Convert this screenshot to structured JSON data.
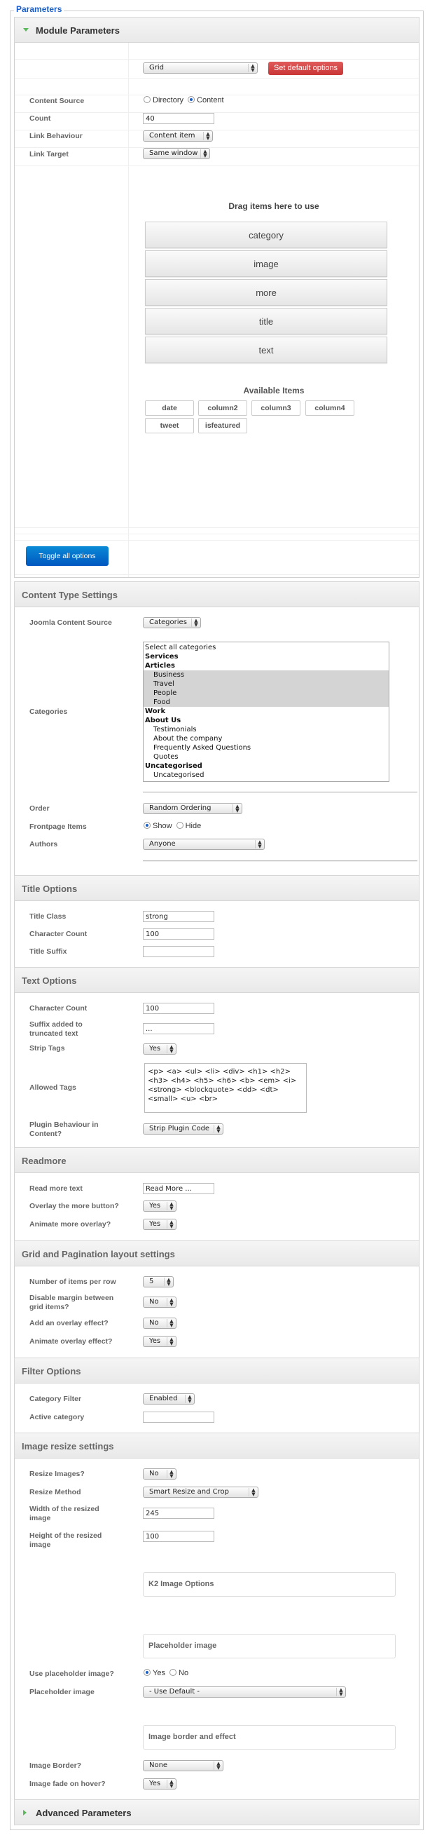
{
  "legend": "Parameters",
  "module_panel": {
    "title": "Module Parameters",
    "layout_select": "Grid",
    "set_default_button": "Set default options",
    "content_source": {
      "label": "Content Source",
      "options": [
        "Directory",
        "Content"
      ],
      "selected": "Content"
    },
    "count": {
      "label": "Count",
      "value": "40"
    },
    "link_behaviour": {
      "label": "Link Behaviour",
      "value": "Content item"
    },
    "link_target": {
      "label": "Link Target",
      "value": "Same window"
    },
    "drag_title": "Drag items here to use",
    "used_items": [
      "category",
      "image",
      "more",
      "title",
      "text"
    ],
    "available_title": "Available Items",
    "available_items": [
      "date",
      "column2",
      "column3",
      "column4",
      "tweet",
      "isfeatured"
    ],
    "toggle_button": "Toggle all options"
  },
  "content_type": {
    "title": "Content Type Settings",
    "joomla_source": {
      "label": "Joomla Content Source",
      "value": "Categories"
    },
    "categories": {
      "label": "Categories",
      "options": [
        {
          "text": "Select all categories",
          "level": 0,
          "bold": false,
          "selected": false
        },
        {
          "text": "Services",
          "level": 0,
          "bold": true,
          "selected": false
        },
        {
          "text": "Articles",
          "level": 0,
          "bold": true,
          "selected": false
        },
        {
          "text": "Business",
          "level": 1,
          "bold": false,
          "selected": true
        },
        {
          "text": "Travel",
          "level": 1,
          "bold": false,
          "selected": true
        },
        {
          "text": "People",
          "level": 1,
          "bold": false,
          "selected": true
        },
        {
          "text": "Food",
          "level": 1,
          "bold": false,
          "selected": true
        },
        {
          "text": "Work",
          "level": 0,
          "bold": true,
          "selected": false
        },
        {
          "text": "About Us",
          "level": 0,
          "bold": true,
          "selected": false
        },
        {
          "text": "Testimonials",
          "level": 1,
          "bold": false,
          "selected": false
        },
        {
          "text": "About the company",
          "level": 1,
          "bold": false,
          "selected": false
        },
        {
          "text": "Frequently Asked Questions",
          "level": 1,
          "bold": false,
          "selected": false
        },
        {
          "text": "Quotes",
          "level": 1,
          "bold": false,
          "selected": false
        },
        {
          "text": "Uncategorised",
          "level": 0,
          "bold": true,
          "selected": false
        },
        {
          "text": "Uncategorised",
          "level": 1,
          "bold": false,
          "selected": false
        }
      ]
    },
    "order": {
      "label": "Order",
      "value": "Random Ordering"
    },
    "frontpage": {
      "label": "Frontpage Items",
      "options": [
        "Show",
        "Hide"
      ],
      "selected": "Show"
    },
    "authors": {
      "label": "Authors",
      "value": "Anyone"
    }
  },
  "title_options": {
    "title": "Title Options",
    "title_class": {
      "label": "Title Class",
      "value": "strong"
    },
    "char_count": {
      "label": "Character Count",
      "value": "100"
    },
    "suffix": {
      "label": "Title Suffix",
      "value": ""
    }
  },
  "text_options": {
    "title": "Text Options",
    "char_count": {
      "label": "Character Count",
      "value": "100"
    },
    "suffix": {
      "label": "Suffix added to truncated text",
      "value": "..."
    },
    "strip_tags": {
      "label": "Strip Tags",
      "value": "Yes"
    },
    "allowed_tags": {
      "label": "Allowed Tags",
      "value": "<p> <a> <ul> <li> <div> <h1> <h2> <h3> <h4> <h5> <h6> <b> <em> <i> <strong> <blockquote> <dd> <dt> <small> <u> <br>"
    },
    "plugin_behaviour": {
      "label": "Plugin Behaviour in Content?",
      "value": "Strip Plugin Code"
    }
  },
  "readmore": {
    "title": "Readmore",
    "text": {
      "label": "Read more text",
      "value": "Read More ..."
    },
    "overlay": {
      "label": "Overlay the more button?",
      "value": "Yes"
    },
    "animate": {
      "label": "Animate more overlay?",
      "value": "Yes"
    }
  },
  "grid": {
    "title": "Grid and Pagination layout settings",
    "per_row": {
      "label": "Number of items per row",
      "value": "5"
    },
    "disable_margin": {
      "label": "Disable margin between grid items?",
      "value": "No"
    },
    "overlay_effect": {
      "label": "Add an overlay effect?",
      "value": "No"
    },
    "animate_overlay": {
      "label": "Animate overlay effect?",
      "value": "Yes"
    }
  },
  "filter": {
    "title": "Filter Options",
    "category_filter": {
      "label": "Category Filter",
      "value": "Enabled"
    },
    "active_category": {
      "label": "Active category",
      "value": ""
    }
  },
  "image_resize": {
    "title": "Image resize settings",
    "resize": {
      "label": "Resize Images?",
      "value": "No"
    },
    "method": {
      "label": "Resize Method",
      "value": "Smart Resize and Crop"
    },
    "width": {
      "label": "Width of the resized image",
      "value": "245"
    },
    "height": {
      "label": "Height of the resized image",
      "value": "100"
    },
    "k2_box": "K2 Image Options",
    "placeholder_box": "Placeholder image",
    "use_placeholder": {
      "label": "Use placeholder image?",
      "options": [
        "Yes",
        "No"
      ],
      "selected": "Yes"
    },
    "placeholder_image": {
      "label": "Placeholder image",
      "value": "- Use Default -"
    },
    "border_box": "Image border and effect",
    "border": {
      "label": "Image Border?",
      "value": "None"
    },
    "fade": {
      "label": "Image fade on hover?",
      "value": "Yes"
    }
  },
  "advanced": {
    "title": "Advanced Parameters"
  },
  "colors": {
    "legend": "#1a5fc8",
    "red_button": "#d64545",
    "blue_button": "#0068c8",
    "triangle": "#5cb85c"
  }
}
